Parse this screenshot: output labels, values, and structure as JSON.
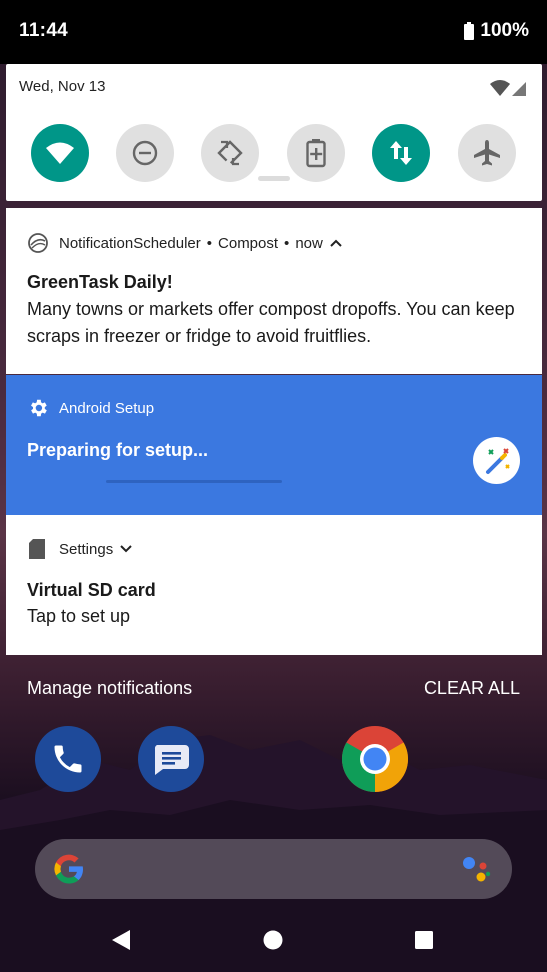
{
  "status_bar": {
    "time": "11:44",
    "battery": "100%"
  },
  "quick_settings": {
    "date": "Wed, Nov 13",
    "tiles": [
      {
        "name": "wifi",
        "state": "on"
      },
      {
        "name": "do-not-disturb",
        "state": "off"
      },
      {
        "name": "auto-rotate",
        "state": "off"
      },
      {
        "name": "battery-saver",
        "state": "off"
      },
      {
        "name": "mobile-data",
        "state": "on"
      },
      {
        "name": "airplane-mode",
        "state": "off"
      }
    ],
    "accent_color": "#009688"
  },
  "notifications": [
    {
      "app": "NotificationScheduler",
      "channel": "Compost",
      "time": "now",
      "title": "GreenTask Daily!",
      "text": "Many towns or markets offer compost dropoffs. You can keep scraps in freezer or fridge to avoid fruitflies."
    },
    {
      "app": "Android Setup",
      "title": "Preparing for setup...",
      "color": "#3b78e0"
    },
    {
      "app": "Settings",
      "title": "Virtual SD card",
      "text": "Tap to set up"
    }
  ],
  "actions": {
    "manage": "Manage notifications",
    "clear_all": "CLEAR ALL"
  },
  "separator": "•"
}
